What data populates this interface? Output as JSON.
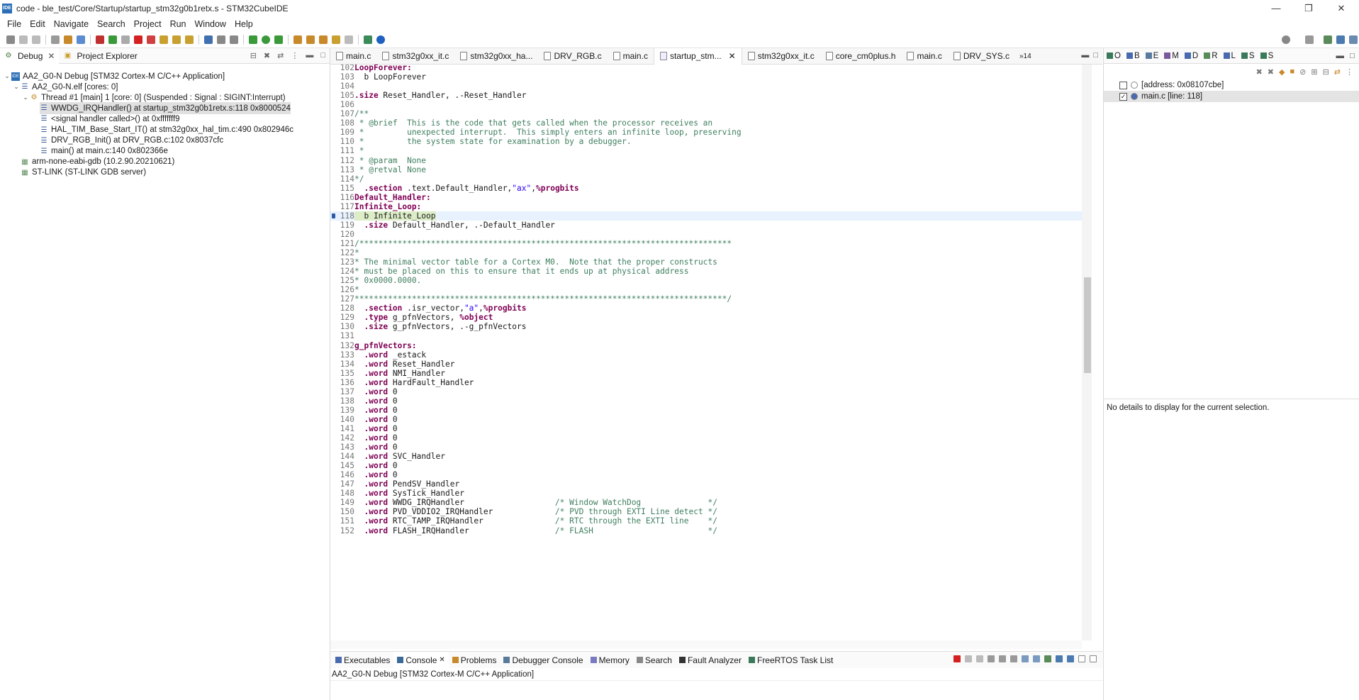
{
  "window": {
    "title": "code - ble_test/Core/Startup/startup_stm32g0b1retx.s - STM32CubeIDE",
    "icon_text": "IDE"
  },
  "menu": [
    "File",
    "Edit",
    "Navigate",
    "Search",
    "Project",
    "Run",
    "Window",
    "Help"
  ],
  "left": {
    "tabs": [
      {
        "label": "Debug"
      },
      {
        "label": "Project Explorer"
      }
    ],
    "tree": [
      {
        "text": "AA2_G0-N Debug [STM32 Cortex-M C/C++ Application]",
        "indent": 0
      },
      {
        "text": "AA2_G0-N.elf [cores: 0]",
        "indent": 1
      },
      {
        "text": "Thread #1 [main] 1 [core: 0] (Suspended : Signal : SIGINT:Interrupt)",
        "indent": 2
      },
      {
        "text": "WWDG_IRQHandler() at startup_stm32g0b1retx.s:118 0x8000524",
        "indent": 3,
        "selected": true
      },
      {
        "text": "<signal handler called>() at 0xfffffff9",
        "indent": 3
      },
      {
        "text": "HAL_TIM_Base_Start_IT() at stm32g0xx_hal_tim.c:490 0x802946c",
        "indent": 3
      },
      {
        "text": "DRV_RGB_Init() at DRV_RGB.c:102 0x8037cfc",
        "indent": 3
      },
      {
        "text": "main() at main.c:140 0x802366e",
        "indent": 3
      },
      {
        "text": "arm-none-eabi-gdb (10.2.90.20210621)",
        "indent": 1
      },
      {
        "text": "ST-LINK (ST-LINK GDB server)",
        "indent": 1
      }
    ]
  },
  "editor": {
    "tabs": [
      {
        "label": "main.c"
      },
      {
        "label": "stm32g0xx_it.c"
      },
      {
        "label": "stm32g0xx_ha..."
      },
      {
        "label": "DRV_RGB.c"
      },
      {
        "label": "main.c"
      },
      {
        "label": "startup_stm...",
        "active": true
      },
      {
        "label": "stm32g0xx_it.c"
      },
      {
        "label": "core_cm0plus.h"
      },
      {
        "label": "main.c"
      },
      {
        "label": "DRV_SYS.c"
      }
    ],
    "overflow": "»14",
    "lines": [
      {
        "n": "102",
        "t": "LoopForever:"
      },
      {
        "n": "103",
        "t": "  b LoopForever"
      },
      {
        "n": "104",
        "t": ""
      },
      {
        "n": "105",
        "t": ".size Reset_Handler, .-Reset_Handler"
      },
      {
        "n": "106",
        "t": ""
      },
      {
        "n": "107",
        "t": "/**"
      },
      {
        "n": "108",
        "t": " * @brief  This is the code that gets called when the processor receives an"
      },
      {
        "n": "109",
        "t": " *         unexpected interrupt.  This simply enters an infinite loop, preserving"
      },
      {
        "n": "110",
        "t": " *         the system state for examination by a debugger."
      },
      {
        "n": "111",
        "t": " *"
      },
      {
        "n": "112",
        "t": " * @param  None"
      },
      {
        "n": "113",
        "t": " * @retval None"
      },
      {
        "n": "114",
        "t": "*/"
      },
      {
        "n": "115",
        "t": "  .section .text.Default_Handler,\"ax\",%progbits"
      },
      {
        "n": "116",
        "t": "Default_Handler:"
      },
      {
        "n": "117",
        "t": "Infinite_Loop:"
      },
      {
        "n": "118",
        "t": "  b Infinite_Loop"
      },
      {
        "n": "119",
        "t": "  .size Default_Handler, .-Default_Handler"
      },
      {
        "n": "120",
        "t": ""
      },
      {
        "n": "121",
        "t": "/******************************************************************************"
      },
      {
        "n": "122",
        "t": "*"
      },
      {
        "n": "123",
        "t": "* The minimal vector table for a Cortex M0.  Note that the proper constructs"
      },
      {
        "n": "124",
        "t": "* must be placed on this to ensure that it ends up at physical address"
      },
      {
        "n": "125",
        "t": "* 0x0000.0000."
      },
      {
        "n": "126",
        "t": "*"
      },
      {
        "n": "127",
        "t": "******************************************************************************/"
      },
      {
        "n": "128",
        "t": "  .section .isr_vector,\"a\",%progbits"
      },
      {
        "n": "129",
        "t": "  .type g_pfnVectors, %object"
      },
      {
        "n": "130",
        "t": "  .size g_pfnVectors, .-g_pfnVectors"
      },
      {
        "n": "131",
        "t": ""
      },
      {
        "n": "132",
        "t": "g_pfnVectors:"
      },
      {
        "n": "133",
        "t": "  .word _estack"
      },
      {
        "n": "134",
        "t": "  .word Reset_Handler"
      },
      {
        "n": "135",
        "t": "  .word NMI_Handler"
      },
      {
        "n": "136",
        "t": "  .word HardFault_Handler"
      },
      {
        "n": "137",
        "t": "  .word 0"
      },
      {
        "n": "138",
        "t": "  .word 0"
      },
      {
        "n": "139",
        "t": "  .word 0"
      },
      {
        "n": "140",
        "t": "  .word 0"
      },
      {
        "n": "141",
        "t": "  .word 0"
      },
      {
        "n": "142",
        "t": "  .word 0"
      },
      {
        "n": "143",
        "t": "  .word 0"
      },
      {
        "n": "144",
        "t": "  .word SVC_Handler"
      },
      {
        "n": "145",
        "t": "  .word 0"
      },
      {
        "n": "146",
        "t": "  .word 0"
      },
      {
        "n": "147",
        "t": "  .word PendSV_Handler"
      },
      {
        "n": "148",
        "t": "  .word SysTick_Handler"
      },
      {
        "n": "149",
        "t": "  .word WWDG_IRQHandler                   /* Window WatchDog              */"
      },
      {
        "n": "150",
        "t": "  .word PVD_VDDIO2_IRQHandler             /* PVD through EXTI Line detect */"
      },
      {
        "n": "151",
        "t": "  .word RTC_TAMP_IRQHandler               /* RTC through the EXTI line    */"
      },
      {
        "n": "152",
        "t": "  .word FLASH_IRQHandler                  /* FLASH                        */"
      }
    ]
  },
  "right": {
    "tabs": [
      "O",
      "B",
      "E",
      "M",
      "D",
      "R",
      "L",
      "S",
      "S"
    ],
    "breakpoints": [
      {
        "text": "[address: 0x08107cbe]",
        "checked": false
      },
      {
        "text": "main.c [line: 118]",
        "checked": true
      }
    ],
    "details": "No details to display for the current selection."
  },
  "bottom": {
    "tabs": [
      {
        "label": "Executables"
      },
      {
        "label": "Console",
        "active": true
      },
      {
        "label": "Problems"
      },
      {
        "label": "Debugger Console"
      },
      {
        "label": "Memory"
      },
      {
        "label": "Search"
      },
      {
        "label": "Fault Analyzer"
      },
      {
        "label": "FreeRTOS Task List"
      }
    ],
    "console_title": "AA2_G0-N Debug [STM32 Cortex-M C/C++ Application]"
  }
}
